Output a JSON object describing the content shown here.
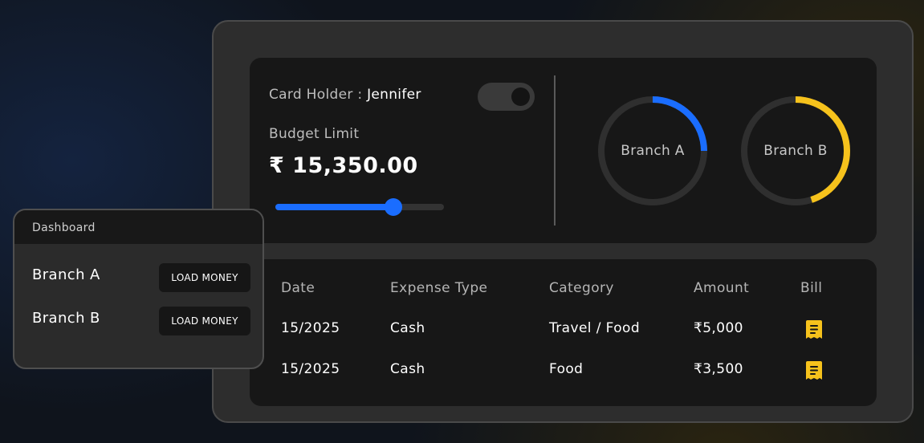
{
  "card": {
    "holder_label": "Card Holder :",
    "holder_name": "Jennifer",
    "budget_label": "Budget Limit",
    "budget_value": "₹ 15,350.00",
    "slider_fraction": 0.7
  },
  "branches": [
    {
      "label": "Branch A",
      "fraction": 0.25,
      "color": "#1a6dff"
    },
    {
      "label": "Branch B",
      "fraction": 0.45,
      "color": "#f6c21c"
    }
  ],
  "table": {
    "headers": [
      "Date",
      "Expense Type",
      "Category",
      "Amount",
      "Bill"
    ],
    "rows": [
      {
        "date": "15/2025",
        "type": "Cash",
        "category": "Travel / Food",
        "amount": "₹5,000",
        "bill_icon": "receipt-icon"
      },
      {
        "date": "15/2025",
        "type": "Cash",
        "category": "Food",
        "amount": "₹3,500",
        "bill_icon": "receipt-icon"
      }
    ]
  },
  "dashboard": {
    "title": "Dashboard",
    "rows": [
      {
        "name": "Branch A",
        "button": "LOAD MONEY"
      },
      {
        "name": "Branch B",
        "button": "LOAD MONEY"
      }
    ]
  },
  "colors": {
    "accent_blue": "#1a6dff",
    "accent_yellow": "#f6c21c"
  }
}
